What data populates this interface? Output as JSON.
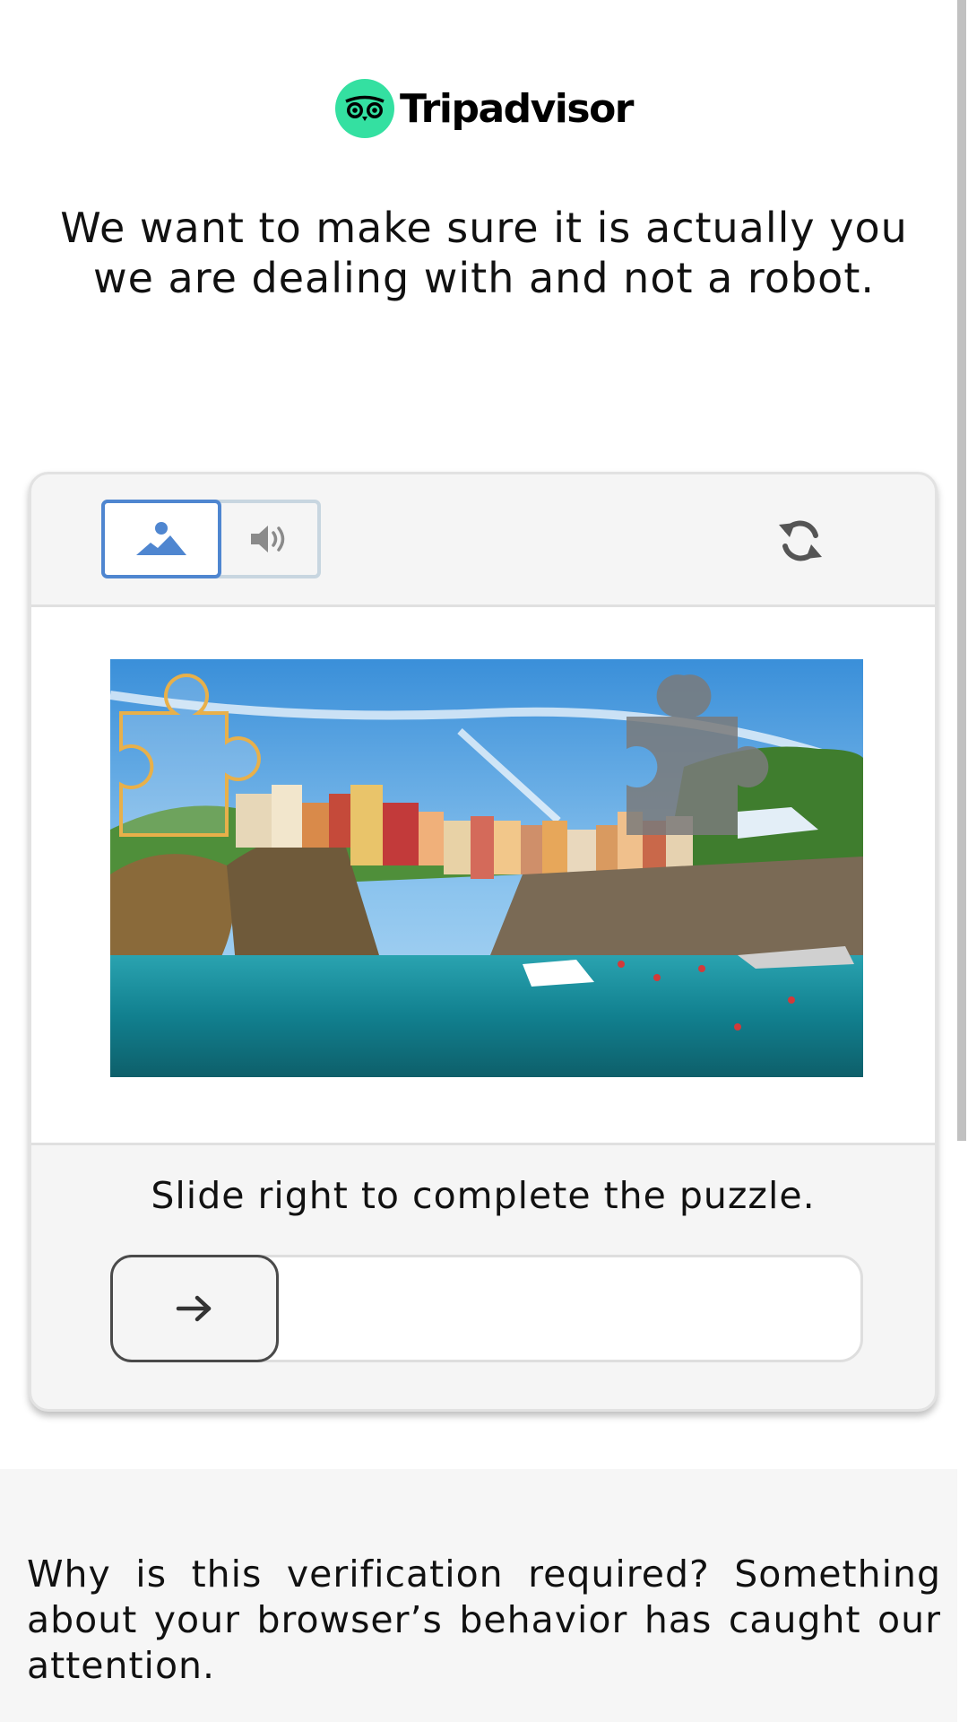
{
  "brand": {
    "name": "Tripadvisor",
    "color": "#34e0a1"
  },
  "headline": "We want to make sure it is actually you we are dealing with and not a robot.",
  "captcha": {
    "modes": [
      {
        "icon": "image-mode-icon",
        "selected": true
      },
      {
        "icon": "speaker-icon",
        "selected": false
      }
    ],
    "refresh_icon": "refresh-icon",
    "image_icon": "landscape-photo",
    "instruction": "Slide right to complete the puzzle.",
    "slider_icon": "arrow-right-icon",
    "slider_progress": 0,
    "accent_color": "#4f86d0",
    "piece_outline_color": "#e8b04a"
  },
  "info": {
    "text": "Why is this verification required? Something about your browser’s behavior has caught our attention."
  }
}
